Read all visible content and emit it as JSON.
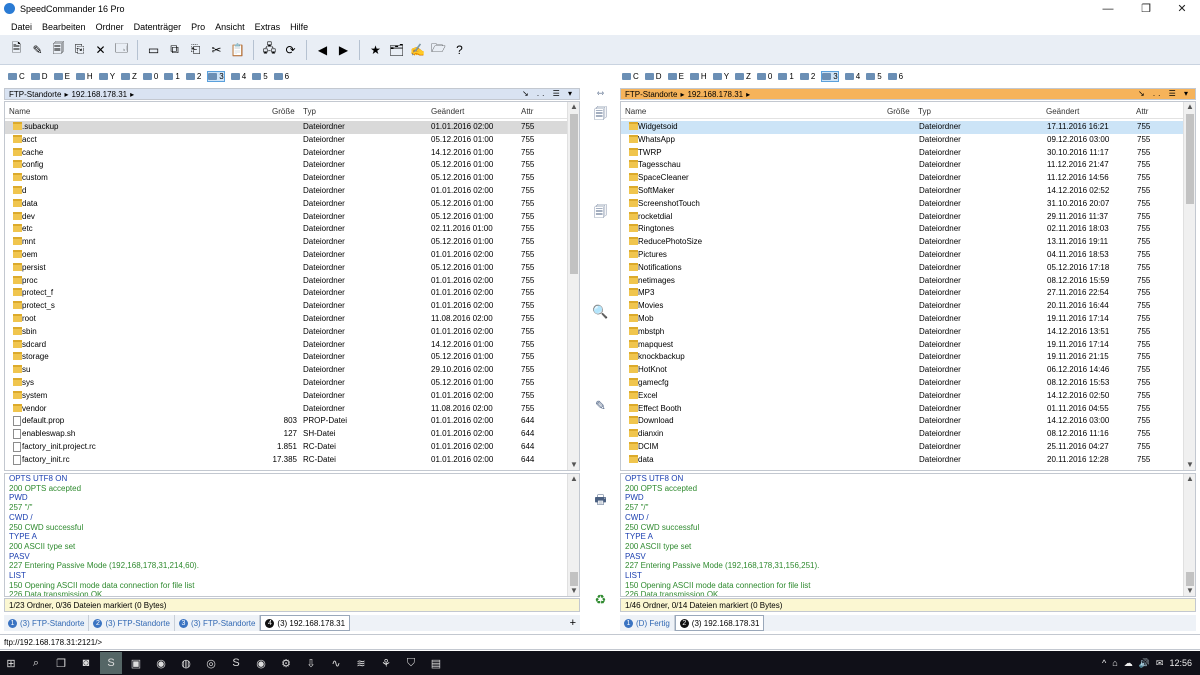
{
  "window": {
    "title": "SpeedCommander 16 Pro",
    "minimize": "—",
    "maximize": "❐",
    "close": "✕"
  },
  "menu": [
    "Datei",
    "Bearbeiten",
    "Ordner",
    "Datenträger",
    "Pro",
    "Ansicht",
    "Extras",
    "Hilfe"
  ],
  "toolbar": {
    "icons": [
      "new-file-icon",
      "edit-icon",
      "view-icon",
      "copy-icon",
      "delete-icon",
      "properties-icon",
      "terminal-icon",
      "compare-icon",
      "clipboard-copy-icon",
      "cut-icon",
      "paste-icon",
      "ftp-icon",
      "favorites-icon",
      "back-icon",
      "forward-icon",
      "bookmark-icon",
      "folder-tree-icon",
      "edit-list-icon",
      "folder-sync-icon",
      "help-icon"
    ],
    "glyphs": [
      "🗎",
      "✎",
      "🗐",
      "⎘",
      "✕",
      "🗔",
      "▭",
      "⧉",
      "⎗",
      "✂",
      "📋",
      "🖧",
      "⟳",
      "◀",
      "▶",
      "★",
      "🗂",
      "✍",
      "🗁",
      "?"
    ]
  },
  "drives": [
    "C",
    "D",
    "E",
    "H",
    "Y",
    "Z",
    "0",
    "1",
    "2",
    "3",
    "4",
    "5",
    "6"
  ],
  "selected_drive": "3",
  "left": {
    "path": [
      "FTP-Standorte",
      "192.168.178.31"
    ],
    "columns": [
      "Name",
      "Größe",
      "Typ",
      "Geändert",
      "Attr"
    ],
    "rows": [
      {
        "name": ".subackup",
        "size": "",
        "type": "Dateiordner",
        "date": "01.01.2016 02:00",
        "attr": "755",
        "kind": "folder"
      },
      {
        "name": "acct",
        "size": "",
        "type": "Dateiordner",
        "date": "05.12.2016 01:00",
        "attr": "755",
        "kind": "folder"
      },
      {
        "name": "cache",
        "size": "",
        "type": "Dateiordner",
        "date": "14.12.2016 01:00",
        "attr": "755",
        "kind": "folder"
      },
      {
        "name": "config",
        "size": "",
        "type": "Dateiordner",
        "date": "05.12.2016 01:00",
        "attr": "755",
        "kind": "folder"
      },
      {
        "name": "custom",
        "size": "",
        "type": "Dateiordner",
        "date": "05.12.2016 01:00",
        "attr": "755",
        "kind": "folder"
      },
      {
        "name": "d",
        "size": "",
        "type": "Dateiordner",
        "date": "01.01.2016 02:00",
        "attr": "755",
        "kind": "folder"
      },
      {
        "name": "data",
        "size": "",
        "type": "Dateiordner",
        "date": "05.12.2016 01:00",
        "attr": "755",
        "kind": "folder"
      },
      {
        "name": "dev",
        "size": "",
        "type": "Dateiordner",
        "date": "05.12.2016 01:00",
        "attr": "755",
        "kind": "folder"
      },
      {
        "name": "etc",
        "size": "",
        "type": "Dateiordner",
        "date": "02.11.2016 01:00",
        "attr": "755",
        "kind": "folder"
      },
      {
        "name": "mnt",
        "size": "",
        "type": "Dateiordner",
        "date": "05.12.2016 01:00",
        "attr": "755",
        "kind": "folder"
      },
      {
        "name": "oem",
        "size": "",
        "type": "Dateiordner",
        "date": "01.01.2016 02:00",
        "attr": "755",
        "kind": "folder"
      },
      {
        "name": "persist",
        "size": "",
        "type": "Dateiordner",
        "date": "05.12.2016 01:00",
        "attr": "755",
        "kind": "folder"
      },
      {
        "name": "proc",
        "size": "",
        "type": "Dateiordner",
        "date": "01.01.2016 02:00",
        "attr": "755",
        "kind": "folder"
      },
      {
        "name": "protect_f",
        "size": "",
        "type": "Dateiordner",
        "date": "01.01.2016 02:00",
        "attr": "755",
        "kind": "folder"
      },
      {
        "name": "protect_s",
        "size": "",
        "type": "Dateiordner",
        "date": "01.01.2016 02:00",
        "attr": "755",
        "kind": "folder"
      },
      {
        "name": "root",
        "size": "",
        "type": "Dateiordner",
        "date": "11.08.2016 02:00",
        "attr": "755",
        "kind": "folder"
      },
      {
        "name": "sbin",
        "size": "",
        "type": "Dateiordner",
        "date": "01.01.2016 02:00",
        "attr": "755",
        "kind": "folder"
      },
      {
        "name": "sdcard",
        "size": "",
        "type": "Dateiordner",
        "date": "14.12.2016 01:00",
        "attr": "755",
        "kind": "folder"
      },
      {
        "name": "storage",
        "size": "",
        "type": "Dateiordner",
        "date": "05.12.2016 01:00",
        "attr": "755",
        "kind": "folder"
      },
      {
        "name": "su",
        "size": "",
        "type": "Dateiordner",
        "date": "29.10.2016 02:00",
        "attr": "755",
        "kind": "folder"
      },
      {
        "name": "sys",
        "size": "",
        "type": "Dateiordner",
        "date": "05.12.2016 01:00",
        "attr": "755",
        "kind": "folder"
      },
      {
        "name": "system",
        "size": "",
        "type": "Dateiordner",
        "date": "01.01.2016 02:00",
        "attr": "755",
        "kind": "folder"
      },
      {
        "name": "vendor",
        "size": "",
        "type": "Dateiordner",
        "date": "11.08.2016 02:00",
        "attr": "755",
        "kind": "folder"
      },
      {
        "name": "default.prop",
        "size": "803",
        "type": "PROP-Datei",
        "date": "01.01.2016 02:00",
        "attr": "644",
        "kind": "file"
      },
      {
        "name": "enableswap.sh",
        "size": "127",
        "type": "SH-Datei",
        "date": "01.01.2016 02:00",
        "attr": "644",
        "kind": "file"
      },
      {
        "name": "factory_init.project.rc",
        "size": "1.851",
        "type": "RC-Datei",
        "date": "01.01.2016 02:00",
        "attr": "644",
        "kind": "file"
      },
      {
        "name": "factory_init.rc",
        "size": "17.385",
        "type": "RC-Datei",
        "date": "01.01.2016 02:00",
        "attr": "644",
        "kind": "file"
      }
    ],
    "log": [
      {
        "t": "OPTS UTF8 ON",
        "c": "b"
      },
      {
        "t": "200 OPTS accepted",
        "c": "g"
      },
      {
        "t": "PWD",
        "c": "b"
      },
      {
        "t": "257 \"/\"",
        "c": "g"
      },
      {
        "t": "CWD /",
        "c": "b"
      },
      {
        "t": "250 CWD successful",
        "c": "g"
      },
      {
        "t": "TYPE A",
        "c": "b"
      },
      {
        "t": "200 ASCII type set",
        "c": "g"
      },
      {
        "t": "PASV",
        "c": "b"
      },
      {
        "t": "227 Entering Passive Mode (192,168,178,31,214,60).",
        "c": "g"
      },
      {
        "t": "LIST",
        "c": "b"
      },
      {
        "t": "150 Opening ASCII mode data connection for file list",
        "c": "g"
      },
      {
        "t": "226 Data transmission OK",
        "c": "g"
      }
    ],
    "status": "1/23 Ordner, 0/36 Dateien markiert (0 Bytes)",
    "tabs": [
      {
        "n": "1",
        "label": "(3) FTP-Standorte",
        "active": false
      },
      {
        "n": "2",
        "label": "(3) FTP-Standorte",
        "active": false
      },
      {
        "n": "3",
        "label": "(3) FTP-Standorte",
        "active": false
      },
      {
        "n": "4",
        "label": "(3) 192.168.178.31",
        "active": true
      }
    ]
  },
  "right": {
    "path": [
      "FTP-Standorte",
      "192.168.178.31"
    ],
    "columns": [
      "Name",
      "Größe",
      "Typ",
      "Geändert",
      "Attr"
    ],
    "rows": [
      {
        "name": "Widgetsoid",
        "size": "",
        "type": "Dateiordner",
        "date": "17.11.2016 16:21",
        "attr": "755",
        "kind": "folder"
      },
      {
        "name": "WhatsApp",
        "size": "",
        "type": "Dateiordner",
        "date": "09.12.2016 03:00",
        "attr": "755",
        "kind": "folder"
      },
      {
        "name": "TWRP",
        "size": "",
        "type": "Dateiordner",
        "date": "30.10.2016 11:17",
        "attr": "755",
        "kind": "folder"
      },
      {
        "name": "Tagesschau",
        "size": "",
        "type": "Dateiordner",
        "date": "11.12.2016 21:47",
        "attr": "755",
        "kind": "folder"
      },
      {
        "name": "SpaceCleaner",
        "size": "",
        "type": "Dateiordner",
        "date": "11.12.2016 14:56",
        "attr": "755",
        "kind": "folder"
      },
      {
        "name": "SoftMaker",
        "size": "",
        "type": "Dateiordner",
        "date": "14.12.2016 02:52",
        "attr": "755",
        "kind": "folder"
      },
      {
        "name": "ScreenshotTouch",
        "size": "",
        "type": "Dateiordner",
        "date": "31.10.2016 20:07",
        "attr": "755",
        "kind": "folder"
      },
      {
        "name": "rocketdial",
        "size": "",
        "type": "Dateiordner",
        "date": "29.11.2016 11:37",
        "attr": "755",
        "kind": "folder"
      },
      {
        "name": "Ringtones",
        "size": "",
        "type": "Dateiordner",
        "date": "02.11.2016 18:03",
        "attr": "755",
        "kind": "folder"
      },
      {
        "name": "ReducePhotoSize",
        "size": "",
        "type": "Dateiordner",
        "date": "13.11.2016 19:11",
        "attr": "755",
        "kind": "folder"
      },
      {
        "name": "Pictures",
        "size": "",
        "type": "Dateiordner",
        "date": "04.11.2016 18:53",
        "attr": "755",
        "kind": "folder"
      },
      {
        "name": "Notifications",
        "size": "",
        "type": "Dateiordner",
        "date": "05.12.2016 17:18",
        "attr": "755",
        "kind": "folder"
      },
      {
        "name": "netimages",
        "size": "",
        "type": "Dateiordner",
        "date": "08.12.2016 15:59",
        "attr": "755",
        "kind": "folder"
      },
      {
        "name": "MP3",
        "size": "",
        "type": "Dateiordner",
        "date": "27.11.2016 22:54",
        "attr": "755",
        "kind": "folder"
      },
      {
        "name": "Movies",
        "size": "",
        "type": "Dateiordner",
        "date": "20.11.2016 16:44",
        "attr": "755",
        "kind": "folder"
      },
      {
        "name": "Mob",
        "size": "",
        "type": "Dateiordner",
        "date": "19.11.2016 17:14",
        "attr": "755",
        "kind": "folder"
      },
      {
        "name": "mbstph",
        "size": "",
        "type": "Dateiordner",
        "date": "14.12.2016 13:51",
        "attr": "755",
        "kind": "folder"
      },
      {
        "name": "mapquest",
        "size": "",
        "type": "Dateiordner",
        "date": "19.11.2016 17:14",
        "attr": "755",
        "kind": "folder"
      },
      {
        "name": "knockbackup",
        "size": "",
        "type": "Dateiordner",
        "date": "19.11.2016 21:15",
        "attr": "755",
        "kind": "folder"
      },
      {
        "name": "HotKnot",
        "size": "",
        "type": "Dateiordner",
        "date": "06.12.2016 14:46",
        "attr": "755",
        "kind": "folder"
      },
      {
        "name": "gamecfg",
        "size": "",
        "type": "Dateiordner",
        "date": "08.12.2016 15:53",
        "attr": "755",
        "kind": "folder"
      },
      {
        "name": "Excel",
        "size": "",
        "type": "Dateiordner",
        "date": "14.12.2016 02:50",
        "attr": "755",
        "kind": "folder"
      },
      {
        "name": "Effect Booth",
        "size": "",
        "type": "Dateiordner",
        "date": "01.11.2016 04:55",
        "attr": "755",
        "kind": "folder"
      },
      {
        "name": "Download",
        "size": "",
        "type": "Dateiordner",
        "date": "14.12.2016 03:00",
        "attr": "755",
        "kind": "folder"
      },
      {
        "name": "dianxin",
        "size": "",
        "type": "Dateiordner",
        "date": "08.12.2016 11:16",
        "attr": "755",
        "kind": "folder"
      },
      {
        "name": "DCIM",
        "size": "",
        "type": "Dateiordner",
        "date": "25.11.2016 04:27",
        "attr": "755",
        "kind": "folder"
      },
      {
        "name": "data",
        "size": "",
        "type": "Dateiordner",
        "date": "20.11.2016 12:28",
        "attr": "755",
        "kind": "folder"
      }
    ],
    "log": [
      {
        "t": "OPTS UTF8 ON",
        "c": "b"
      },
      {
        "t": "200 OPTS accepted",
        "c": "g"
      },
      {
        "t": "PWD",
        "c": "b"
      },
      {
        "t": "257 \"/\"",
        "c": "g"
      },
      {
        "t": "CWD /",
        "c": "b"
      },
      {
        "t": "250 CWD successful",
        "c": "g"
      },
      {
        "t": "TYPE A",
        "c": "b"
      },
      {
        "t": "200 ASCII type set",
        "c": "g"
      },
      {
        "t": "PASV",
        "c": "b"
      },
      {
        "t": "227 Entering Passive Mode (192,168,178,31,156,251).",
        "c": "g"
      },
      {
        "t": "LIST",
        "c": "b"
      },
      {
        "t": "150 Opening ASCII mode data connection for file list",
        "c": "g"
      },
      {
        "t": "226 Data transmission OK",
        "c": "g"
      }
    ],
    "status": "1/46 Ordner, 0/14 Dateien markiert (0 Bytes)",
    "tabs": [
      {
        "n": "1",
        "label": "(D) Fertig",
        "active": false
      },
      {
        "n": "2",
        "label": "(3) 192.168.178.31",
        "active": true
      }
    ]
  },
  "tab_add": "+",
  "command_line": "ftp://192.168.178.31:2121/>",
  "taskbar": {
    "clock": "12:56",
    "tray": [
      "^",
      "⌂",
      "☁",
      "🔊",
      "✉"
    ]
  },
  "colors": {
    "accent": "#2a7bd4",
    "log_command": "#1b3fb0",
    "log_reply": "#2f8a2f",
    "status_bg": "#fbf7d2",
    "focus_row": "#cce4f7",
    "right_path_bg": "#f6b35a",
    "left_path_bg": "#d9e3f2"
  }
}
